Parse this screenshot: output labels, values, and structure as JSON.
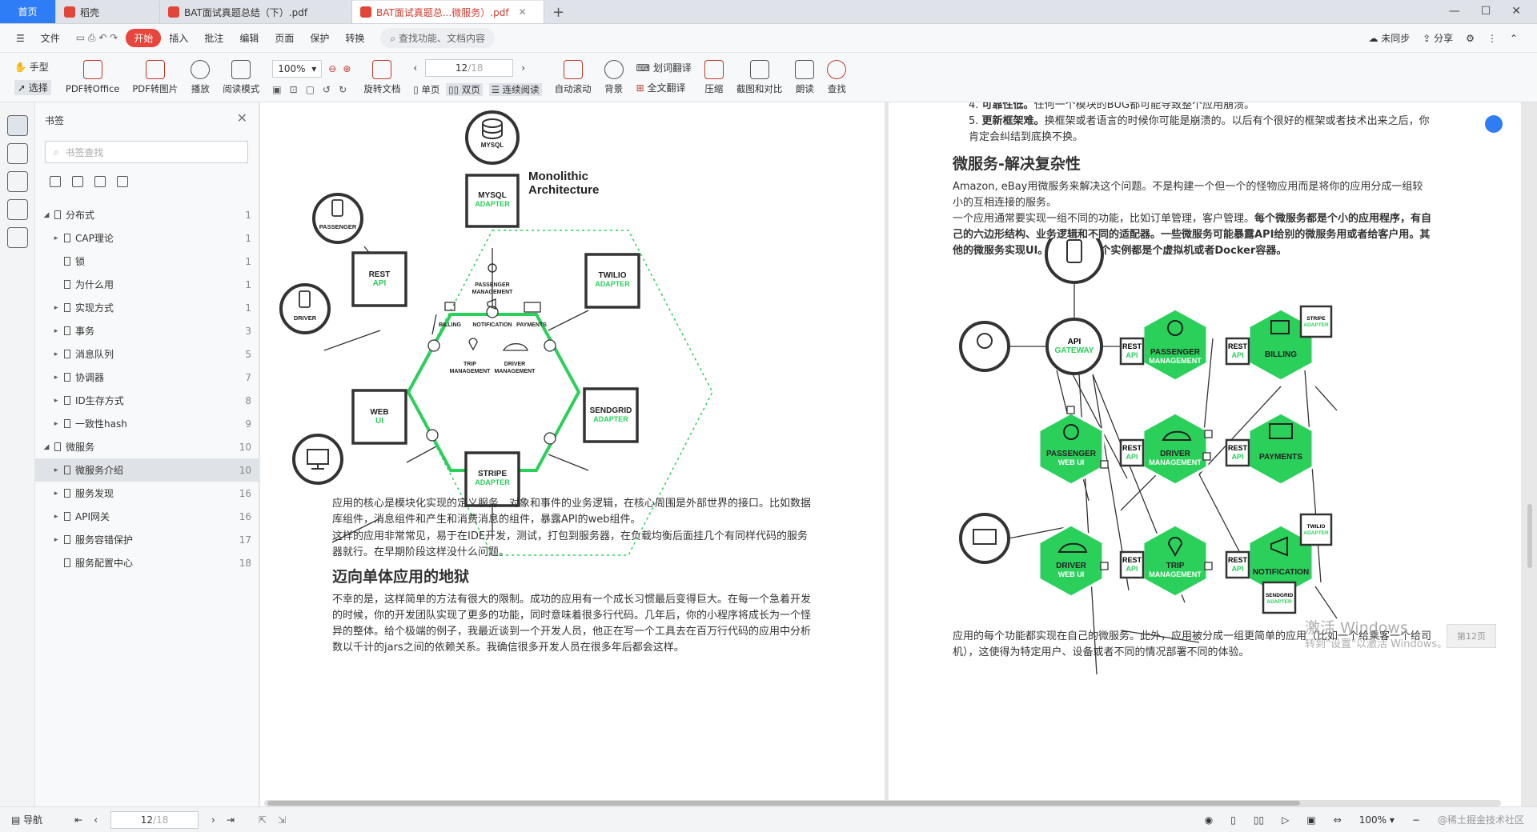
{
  "tabs": [
    {
      "label": "首页"
    },
    {
      "label": "稻壳"
    },
    {
      "label": "BAT面试真题总结（下）.pdf"
    },
    {
      "label": "BAT面试真题总...微服务）.pdf"
    }
  ],
  "tab_add": "+",
  "menu": {
    "file": "文件",
    "items": [
      "开始",
      "插入",
      "批注",
      "编辑",
      "页面",
      "保护",
      "转换"
    ],
    "search": "查找功能、文档内容",
    "sync": "未同步",
    "share": "分享"
  },
  "toolbar": {
    "hand": "手型",
    "select": "选择",
    "pdf_office": "PDF转Office",
    "pdf_image": "PDF转图片",
    "play": "播放",
    "read_mode": "阅读模式",
    "zoom": "100%",
    "rotate": "旋转文档",
    "page_current": "12",
    "page_total": "/18",
    "single": "单页",
    "double": "双页",
    "continuous": "连续阅读",
    "autoscroll": "自动滚动",
    "background": "背景",
    "word_translate": "划词翻译",
    "full_translate": "全文翻译",
    "compress": "压缩",
    "screenshot": "截图和对比",
    "read_aloud": "朗读",
    "find": "查找"
  },
  "bookmark": {
    "title": "书签",
    "search_placeholder": "书签查找",
    "items": [
      {
        "label": "分布式",
        "page": "1",
        "level": 0,
        "arrow": "◢"
      },
      {
        "label": "CAP理论",
        "page": "1",
        "level": 1,
        "arrow": "▸"
      },
      {
        "label": "锁",
        "page": "1",
        "level": 1,
        "arrow": ""
      },
      {
        "label": "为什么用",
        "page": "1",
        "level": 1,
        "arrow": ""
      },
      {
        "label": "实现方式",
        "page": "1",
        "level": 1,
        "arrow": "▸"
      },
      {
        "label": "事务",
        "page": "3",
        "level": 1,
        "arrow": "▸"
      },
      {
        "label": "消息队列",
        "page": "5",
        "level": 1,
        "arrow": "▸"
      },
      {
        "label": "协调器",
        "page": "7",
        "level": 1,
        "arrow": "▸"
      },
      {
        "label": "ID生存方式",
        "page": "8",
        "level": 1,
        "arrow": "▸"
      },
      {
        "label": "一致性hash",
        "page": "9",
        "level": 1,
        "arrow": "▸"
      },
      {
        "label": "微服务",
        "page": "10",
        "level": 0,
        "arrow": "◢"
      },
      {
        "label": "微服务介绍",
        "page": "10",
        "level": 1,
        "arrow": "▸",
        "selected": true
      },
      {
        "label": "服务发现",
        "page": "16",
        "level": 1,
        "arrow": "▸"
      },
      {
        "label": "API网关",
        "page": "16",
        "level": 1,
        "arrow": "▸"
      },
      {
        "label": "服务容错保护",
        "page": "17",
        "level": 1,
        "arrow": "▸"
      },
      {
        "label": "服务配置中心",
        "page": "18",
        "level": 1,
        "arrow": ""
      }
    ]
  },
  "left_page": {
    "diagram": {
      "title_line1": "Monolithic",
      "title_line2": "Architecture",
      "mysql": "MYSQL",
      "mysql_adapter_1": "MYSQL",
      "mysql_adapter_2": "ADAPTER",
      "passenger": "PASSENGER",
      "driver": "DRIVER",
      "rest_api_1": "REST",
      "rest_api_2": "API",
      "web_ui_1": "WEB",
      "web_ui_2": "UI",
      "twilio_1": "TWILIO",
      "twilio_2": "ADAPTER",
      "sendgrid_1": "SENDGRID",
      "sendgrid_2": "ADAPTER",
      "stripe_1": "STRIPE",
      "stripe_2": "ADAPTER",
      "core_pm_1": "PASSENGER",
      "core_pm_2": "MANAGEMENT",
      "billing": "BILLING",
      "notification": "NOTIFICATION",
      "payments": "PAYMENTS",
      "trip_1": "TRIP",
      "trip_2": "MANAGEMENT",
      "driver_m_1": "DRIVER",
      "driver_m_2": "MANAGEMENT"
    },
    "para1": "应用的核心是模块化实现的定义服务、对象和事件的业务逻辑，在核心周围是外部世界的接口。比如数据库组件，消息组件和产生和消费消息的组件，暴露API的web组件。",
    "para2": "这样的应用非常常见，易于在IDE开发，测试，打包到服务器，在负载均衡后面挂几个有同样代码的服务器就行。在早期阶段这样没什么问题。",
    "heading": "迈向单体应用的地狱",
    "para3": "不幸的是，这样简单的方法有很大的限制。成功的应用有一个成长习惯最后变得巨大。在每一个急着开发的时候，你的开发团队实现了更多的功能，同时意味着很多行代码。几年后，你的小程序将成长为一个怪异的整体。给个极端的例子，我最近谈到一个开发人员，他正在写一个工具去在百万行代码的应用中分析数以千计的jars之间的依赖关系。我确信很多开发人员在很多年后都会这样。"
  },
  "right_page": {
    "item4_num": "4.",
    "item4_bold": "可靠性低。",
    "item4_text": "任何一个模块的BUG都可能导致整个应用崩溃。",
    "item5_num": "5.",
    "item5_bold": "更新框架难。",
    "item5_text": "换框架或者语言的时候你可能是崩溃的。以后有个很好的框架或者技术出来之后，你肯定会纠结到底换不换。",
    "heading": "微服务-解决复杂性",
    "para1": "Amazon, eBay用微服务来解决这个问题。不是构建一个但一个的怪物应用而是将你的应用分成一组较小的互相连接的服务。",
    "para2_normal": "一个应用通常要实现一组不同的功能，比如订单管理，客户管理。",
    "para2_bold": "每个微服务都是个小的应用程序，有自己的六边形结构、业务逻辑和不同的适配器。一些微服务可能暴露API给别的微服务用或者给客户用。其他的微服务实现UI。运行时，每个实例都是个虚拟机或者Docker容器。",
    "diagram": {
      "api_gw_1": "API",
      "api_gw_2": "GATEWAY",
      "rest": "REST",
      "api": "API",
      "pm_1": "PASSENGER",
      "pm_2": "MANAGEMENT",
      "billing": "BILLING",
      "stripe_1": "STRIPE",
      "stripe_2": "ADAPTER",
      "pw_1": "PASSENGER",
      "pw_2": "WEB UI",
      "dm_1": "DRIVER",
      "dm_2": "MANAGEMENT",
      "payments": "PAYMENTS",
      "dw_1": "DRIVER",
      "dw_2": "WEB UI",
      "tm_1": "TRIP",
      "tm_2": "MANAGEMENT",
      "notification": "NOTIFICATION",
      "twilio_1": "TWILIO",
      "twilio_2": "ADAPTER",
      "sendgrid_1": "SENDGRID",
      "sendgrid_2": "ADAPTER"
    },
    "para3": "应用的每个功能都实现在自己的微服务。此外，应用被分成一组更简单的应用（比如一个给乘客一个给司机），这使得为特定用户、设备或者不同的情况部署不同的体验。"
  },
  "activation": {
    "line1": "激活 Windows",
    "line2": "转到\"设置\"以激活 Windows。"
  },
  "page_badge": "第12页",
  "status": {
    "nav": "导航",
    "page_current": "12",
    "page_total": "/18",
    "zoom": "100%",
    "credit": "@稀土掘金技术社区"
  },
  "colors": {
    "accent_red": "#e8453c",
    "home_blue": "#2f7df6",
    "green": "#2ad05a",
    "dark": "#333333"
  }
}
